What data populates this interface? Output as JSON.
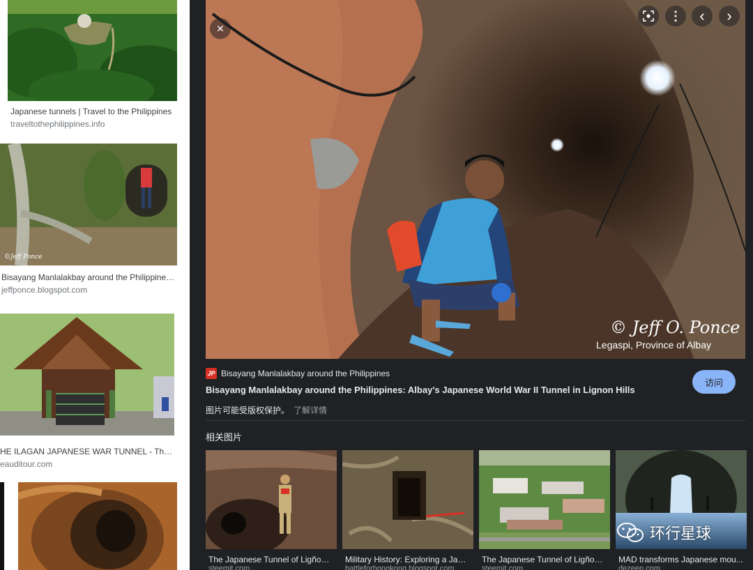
{
  "left_results": [
    {
      "title": "Japanese tunnels | Travel to the Philippines",
      "source": "traveltothephilippines.info"
    },
    {
      "title": "Bisayang Manlalakbay around the Philippines:...",
      "source": "jeffponce.blogspot.com"
    },
    {
      "title": "HE ILAGAN JAPANESE WAR TUNNEL - The Aud...",
      "source": "eauditour.com"
    }
  ],
  "preview": {
    "photo_credit": "© Jeff O. Ponce",
    "photo_location": "Legaspi, Province of Albay",
    "site_name": "Bisayang Manlalakbay around the Philippines",
    "favicon_text": "JP",
    "title": "Bisayang Manlalakbay around the Philippines: Albay's Japanese World War II Tunnel in Lignon Hills",
    "visit_label": "访问",
    "copyright_notice": "图片可能受版权保护。",
    "learn_more": "了解详情",
    "controls": {
      "close": "✕",
      "lens": "lens-icon",
      "more": "⋮",
      "prev": "‹",
      "next": "›"
    }
  },
  "related": {
    "heading": "相关图片",
    "items": [
      {
        "title": "The Japanese Tunnel of Ligñon ...",
        "source": "steemit.com"
      },
      {
        "title": "Military History: Exploring a Japa...",
        "source": "battleforhongkong.blogspot.com"
      },
      {
        "title": "The Japanese Tunnel of Ligñon ...",
        "source": "steemit.com"
      },
      {
        "title": "MAD transforms Japanese mou...",
        "source": "dezeen.com"
      }
    ]
  },
  "watermark": {
    "text": "环行星球"
  },
  "colors": {
    "panel_bg": "#202124",
    "accent_button": "#8ab4f8"
  }
}
